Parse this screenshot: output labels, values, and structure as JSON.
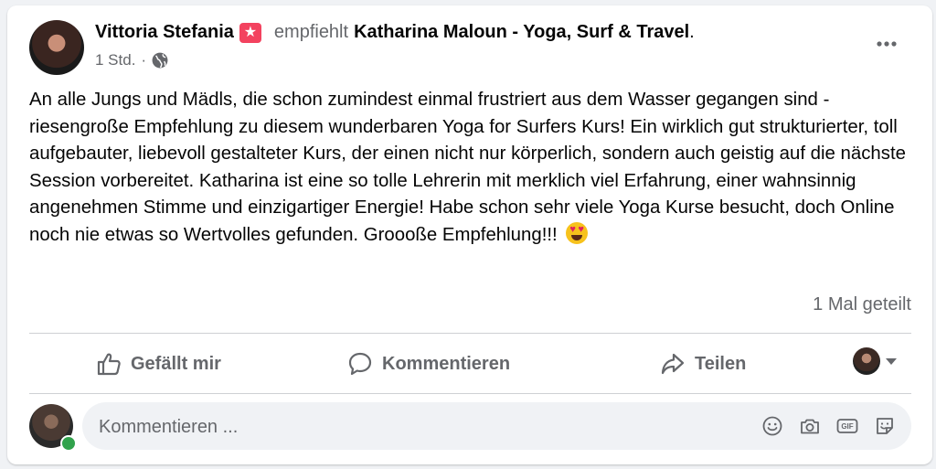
{
  "post": {
    "author": "Vittoria Stefania",
    "verb": "empfiehlt",
    "page": "Katharina Maloun - Yoga, Surf & Travel",
    "punct": ".",
    "time": "1 Std.",
    "text": "An alle Jungs und Mädls, die schon zumindest einmal frustriert aus dem Wasser gegangen sind - riesengroße Empfehlung zu diesem wunderbaren Yoga for Surfers Kurs! Ein wirklich gut strukturierter, toll aufgebauter, liebevoll gestalteter Kurs, der einen nicht nur körperlich, sondern auch geistig auf die nächste Session vorbereitet. Katharina ist eine so tolle Lehrerin mit merklich viel Erfahrung, einer wahnsinnig angenehmen Stimme und einzigartiger Energie! Habe schon sehr viele Yoga Kurse besucht, doch Online noch nie etwas so Wertvolles gefunden. Groooße Empfehlung!!!",
    "shares": "1 Mal geteilt"
  },
  "actions": {
    "like": "Gefällt mir",
    "comment": "Kommentieren",
    "share": "Teilen"
  },
  "comment": {
    "placeholder": "Kommentieren ..."
  },
  "icons": {
    "recommend_badge": "star-badge-icon",
    "privacy": "globe-icon",
    "more": "more-icon",
    "like": "thumbs-up-icon",
    "comment": "speech-bubble-icon",
    "share": "share-arrow-icon",
    "comment_tools": [
      "emoji-icon",
      "camera-icon",
      "gif-icon",
      "sticker-icon"
    ]
  },
  "colors": {
    "badge": "#f3425f",
    "online": "#31a24c",
    "muted": "#65676b"
  }
}
